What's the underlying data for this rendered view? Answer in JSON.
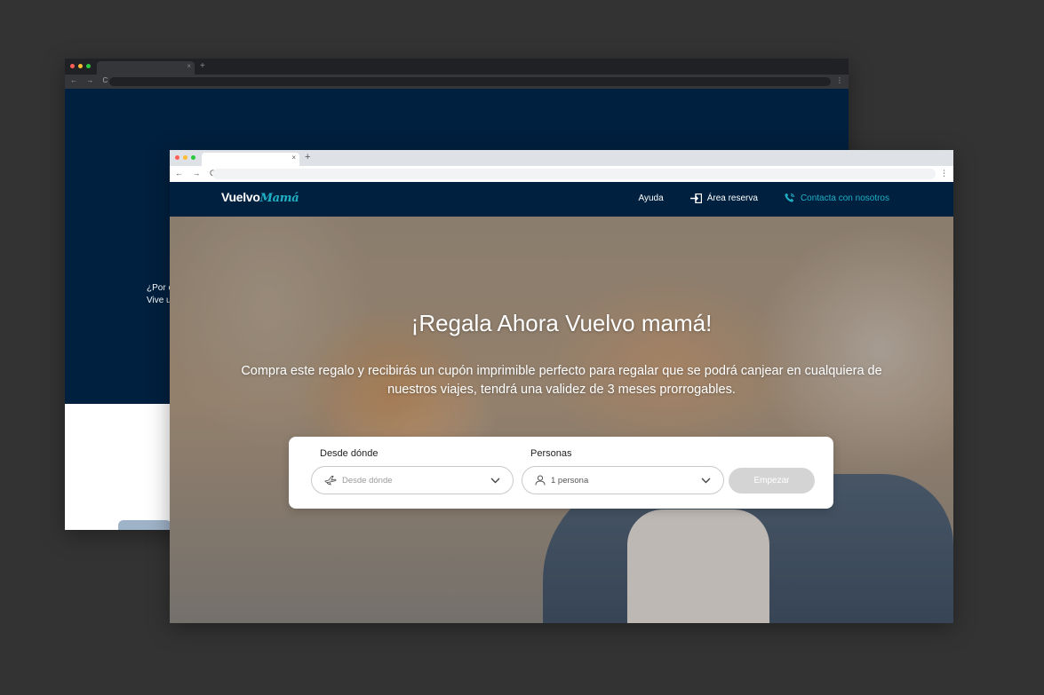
{
  "front": {
    "logo": {
      "small": "",
      "main": "Vuelvo",
      "accent": "Mamá"
    },
    "nav": {
      "help": "Ayuda",
      "booking_area": "Área reserva",
      "contact": "Contacta con nosotros"
    },
    "hero": {
      "title": "¡Regala Ahora Vuelvo mamá!",
      "subtitle": "Compra este regalo y recibirás un cupón imprimible perfecto para regalar que se podrá canjear en cualquiera de nuestros viajes, tendrá una validez de 3 meses prorrogables."
    },
    "search": {
      "from_label": "Desde dónde",
      "from_placeholder": "Desde dónde",
      "people_label": "Personas",
      "people_value": "1 persona",
      "start_label": "Empezar"
    },
    "chrome": {
      "tab_close": "×",
      "new_tab": "+",
      "nav_buttons": "← → C",
      "menu": "⋮"
    }
  },
  "back": {
    "text_line1": "¿Por c",
    "text_line2": "Vive u",
    "chrome": {
      "tab_close": "×",
      "new_tab": "+",
      "nav_buttons": "← → C",
      "menu": "⋮"
    }
  },
  "colors": {
    "navy": "#00203f",
    "accent": "#1fb0c4",
    "canvas": "#333333",
    "button_disabled": "#d4d4d4"
  }
}
